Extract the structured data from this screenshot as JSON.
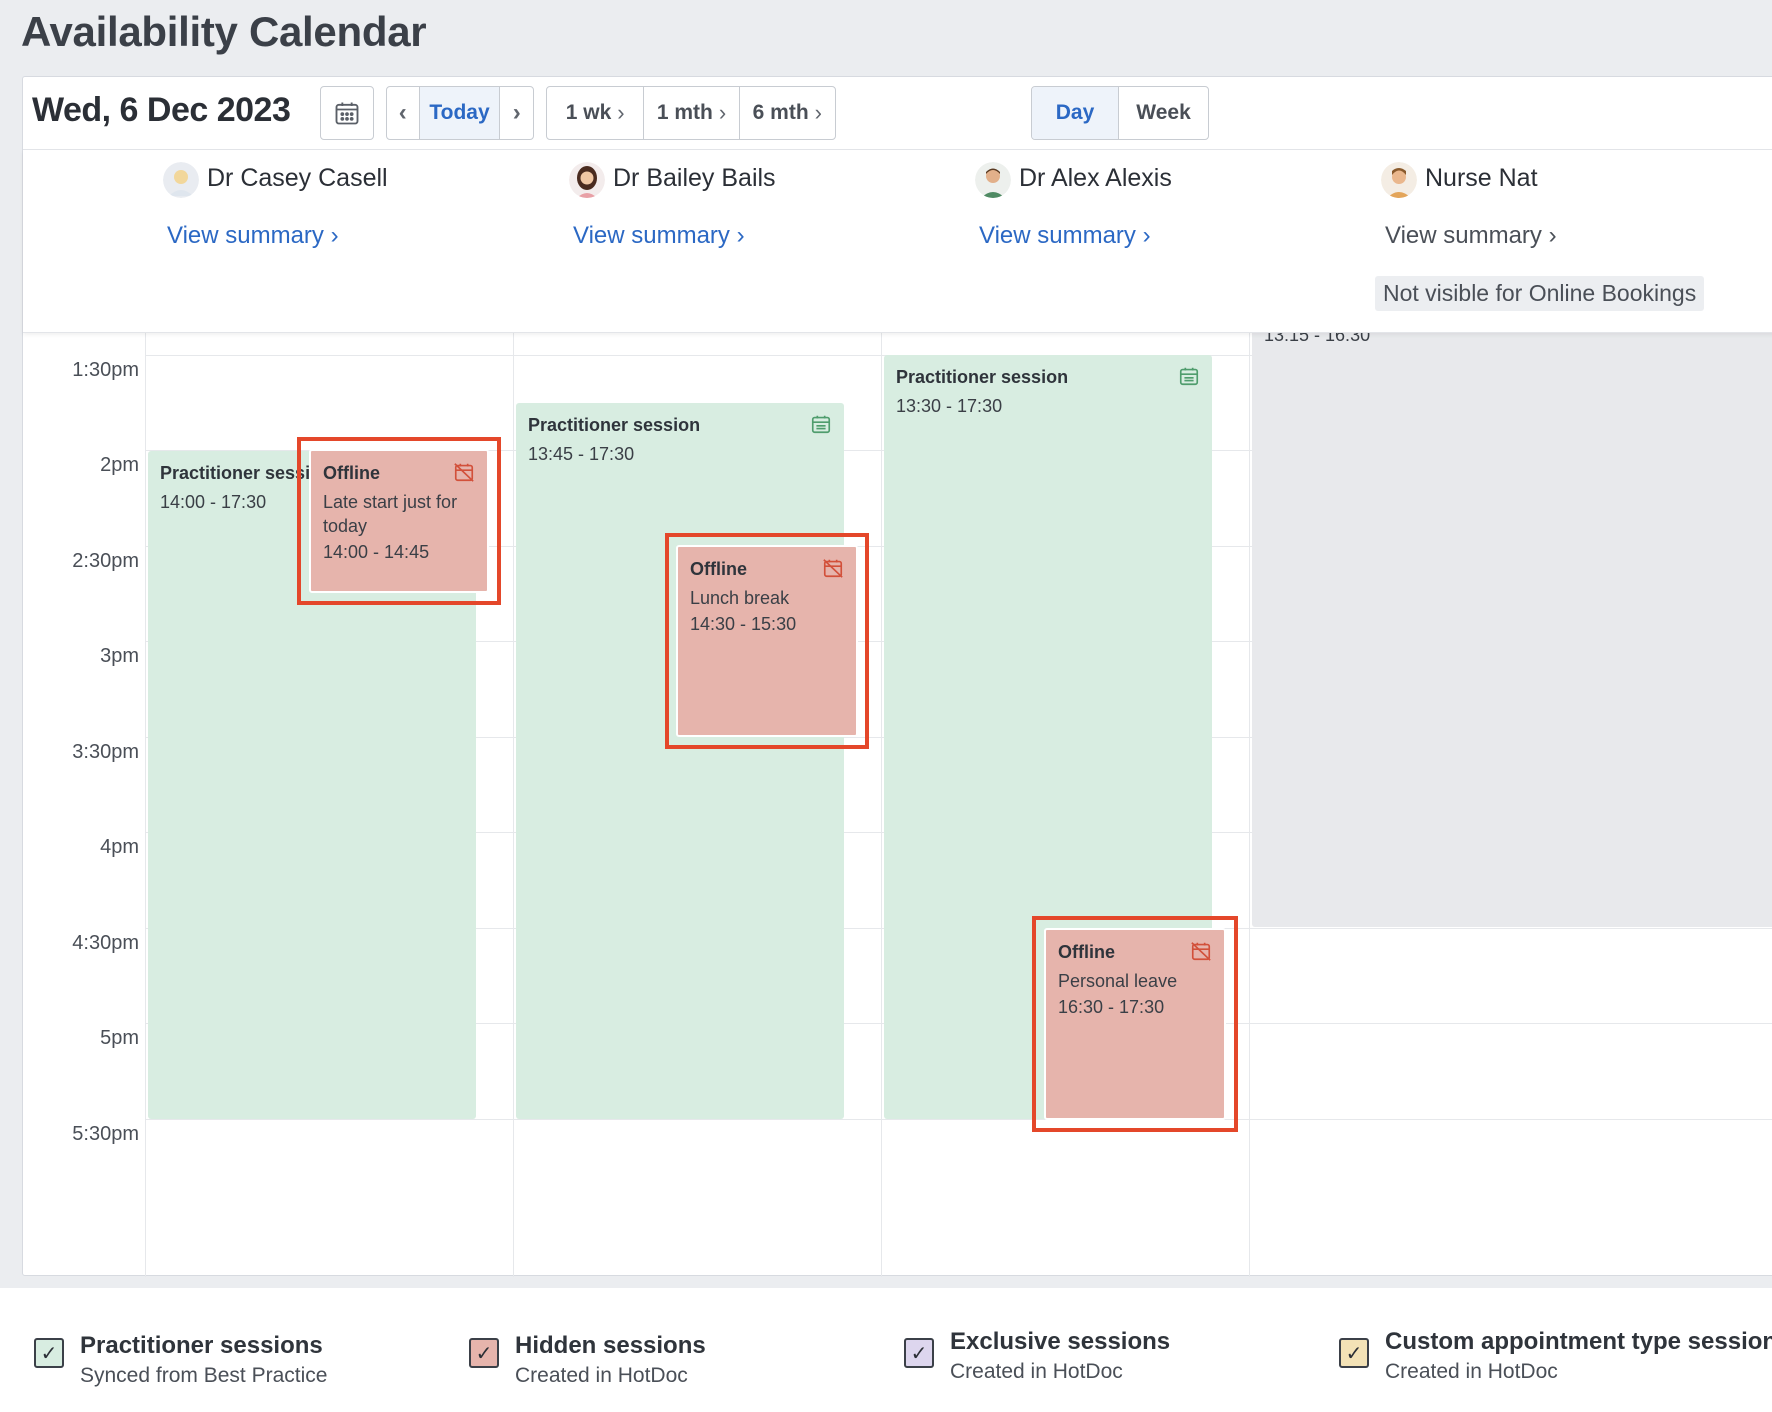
{
  "page": {
    "title": "Availability Calendar"
  },
  "toolbar": {
    "date": "Wed, 6 Dec 2023",
    "today": "Today",
    "range_buttons": [
      "1 wk",
      "1 mth",
      "6 mth"
    ],
    "views": [
      "Day",
      "Week"
    ],
    "active_view": "Day",
    "icons": {
      "calendar": "calendar-icon",
      "prev": "chevron-left-icon",
      "next": "chevron-right-icon"
    }
  },
  "practitioners": [
    {
      "name": "Dr Casey Casell",
      "link": "View summary ›"
    },
    {
      "name": "Dr Bailey Bails",
      "link": "View summary ›"
    },
    {
      "name": "Dr Alex Alexis",
      "link": "View summary ›"
    },
    {
      "name": "Nurse Nat",
      "link": "View summary ›",
      "badge": "Not visible for Online Bookings"
    }
  ],
  "time_labels": [
    "1:30pm",
    "2pm",
    "2:30pm",
    "3pm",
    "3:30pm",
    "4pm",
    "4:30pm",
    "5pm",
    "5:30pm"
  ],
  "sessions": [
    {
      "title": "Practitioner session",
      "time": "14:00 - 17:30"
    },
    {
      "title": "Practitioner session",
      "time": "13:45 - 17:30"
    },
    {
      "title": "Practitioner session",
      "time": "13:30 - 17:30"
    },
    {
      "time": "13:15 - 16:30"
    }
  ],
  "offline": [
    {
      "title": "Offline",
      "desc": "Late start just for today",
      "time": "14:00 - 14:45"
    },
    {
      "title": "Offline",
      "desc": "Lunch break",
      "time": "14:30 - 15:30"
    },
    {
      "title": "Offline",
      "desc": "Personal leave",
      "time": "16:30 - 17:30"
    }
  ],
  "legend": [
    {
      "title": "Practitioner sessions",
      "sub": "Synced from Best Practice",
      "color": "#d8ede1"
    },
    {
      "title": "Hidden sessions",
      "sub": "Created in HotDoc",
      "color": "#e6b4ac"
    },
    {
      "title": "Exclusive sessions",
      "sub": "Created in HotDoc",
      "color": "#ddd6ee"
    },
    {
      "title": "Custom appointment type sessions",
      "sub": "Created in HotDoc",
      "color": "#f3e2b6"
    }
  ],
  "colors": {
    "accent": "#2b68c4",
    "session": "#d8ede1",
    "offline": "#e6b4ac",
    "highlight": "#e4472a"
  }
}
